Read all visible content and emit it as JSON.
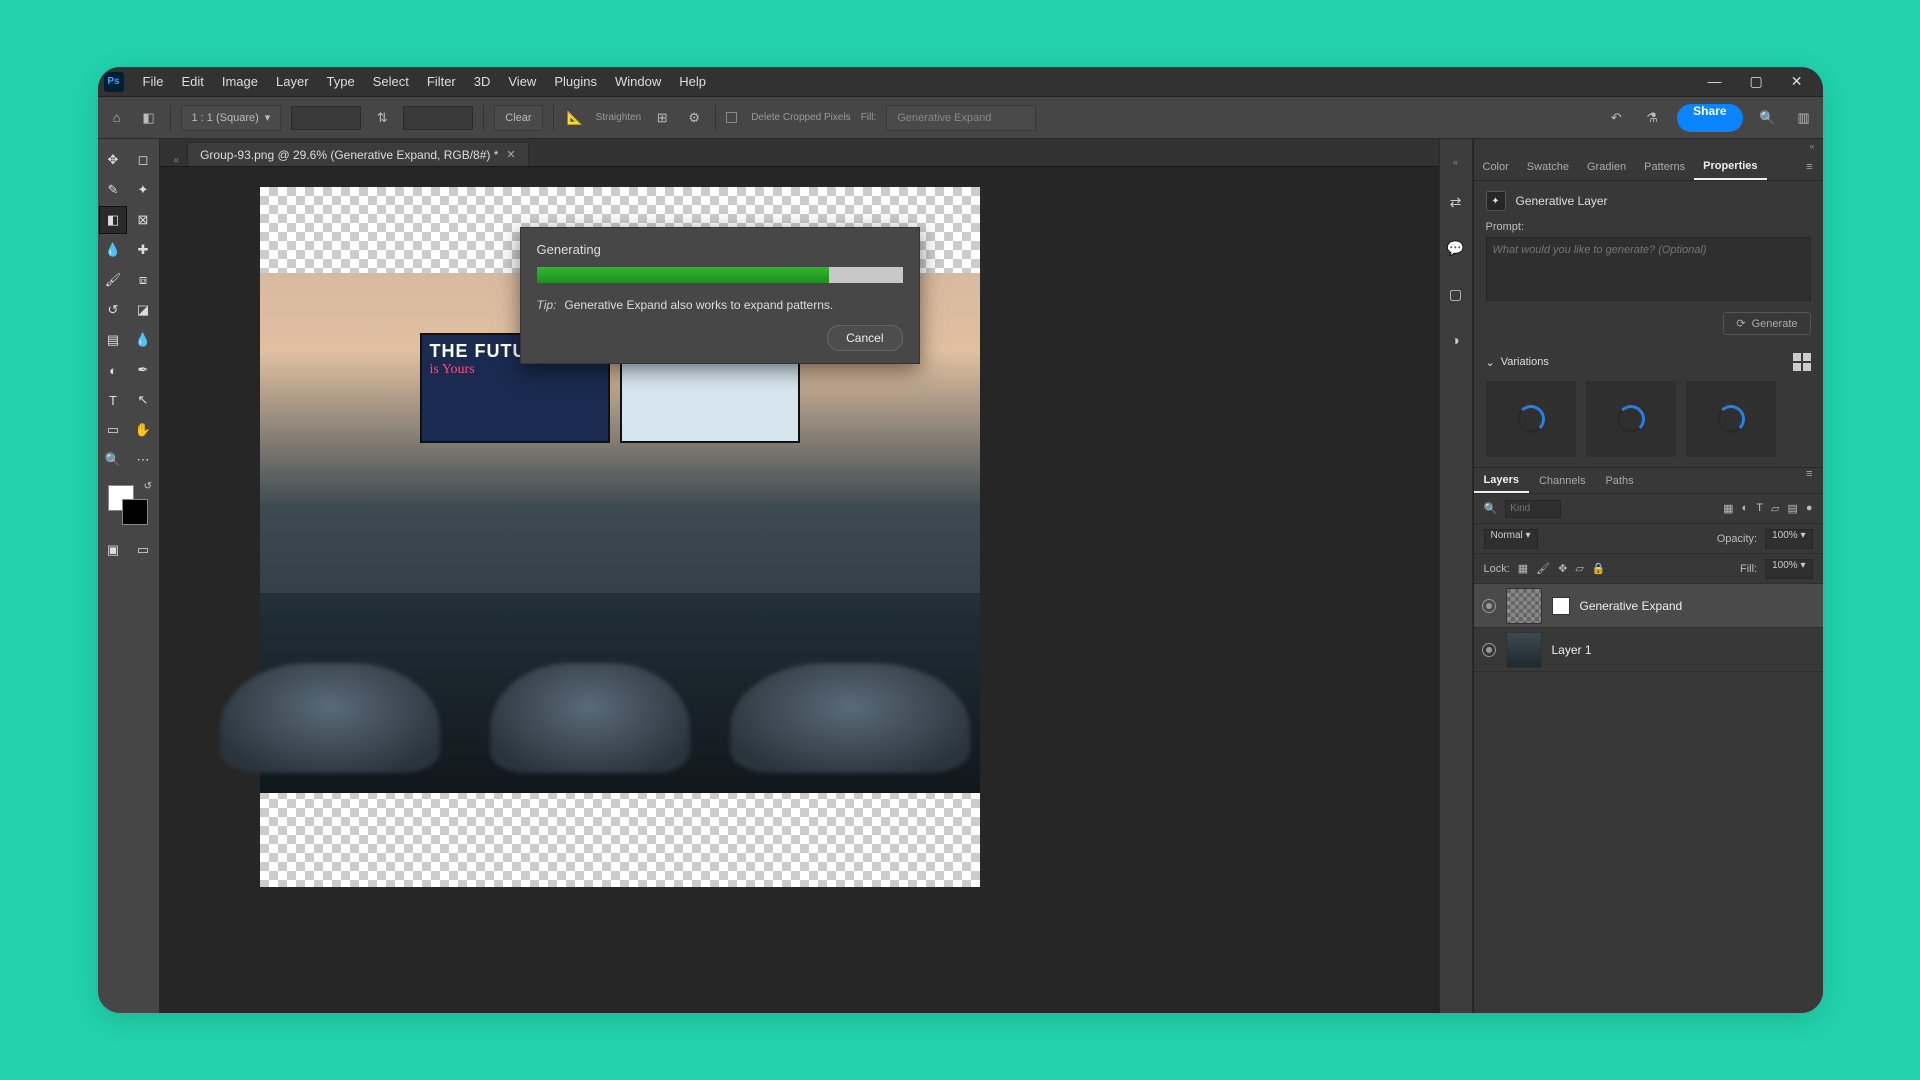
{
  "menus": [
    "File",
    "Edit",
    "Image",
    "Layer",
    "Type",
    "Select",
    "Filter",
    "3D",
    "View",
    "Plugins",
    "Window",
    "Help"
  ],
  "share_label": "Share",
  "optbar": {
    "ratio": "1 : 1 (Square)",
    "w": "",
    "h": "",
    "clear": "Clear",
    "straighten": "Straighten",
    "delete_cropped": "Delete Cropped Pixels",
    "fill_label": "Fill:",
    "fill_value": "Generative Expand"
  },
  "doc_tab": "Group-93.png @ 29.6% (Generative Expand, RGB/8#) *",
  "dialog": {
    "title": "Generating",
    "tip_label": "Tip:",
    "tip_text": "Generative Expand also works to expand patterns.",
    "cancel": "Cancel",
    "progress_pct": 80
  },
  "right_tabs": [
    "Color",
    "Swatche",
    "Gradien",
    "Patterns",
    "Properties"
  ],
  "properties": {
    "layer_type": "Generative Layer",
    "prompt_label": "Prompt:",
    "prompt_placeholder": "What would you like to generate? (Optional)",
    "generate_btn": "Generate",
    "variations_label": "Variations"
  },
  "layers_panel": {
    "tabs": [
      "Layers",
      "Channels",
      "Paths"
    ],
    "kind_placeholder": "Kind",
    "blend_mode": "Normal",
    "opacity_label": "Opacity:",
    "opacity_value": "100%",
    "lock_label": "Lock:",
    "fill_label": "Fill:",
    "fill_value": "100%",
    "layers": [
      {
        "name": "Generative Expand",
        "selected": true
      },
      {
        "name": "Layer 1",
        "selected": false
      }
    ]
  },
  "billboard_title": "THE FUTURE",
  "billboard_sub": "is Yours"
}
